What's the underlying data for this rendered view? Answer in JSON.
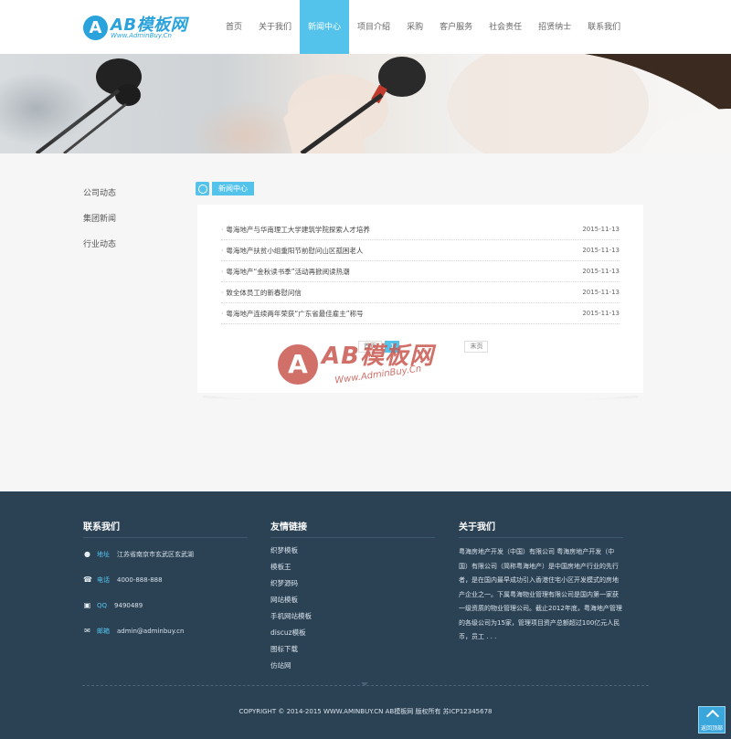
{
  "logo": {
    "mark": "A",
    "name": "AB模板网",
    "sub": "Www.AdminBuy.Cn"
  },
  "nav": [
    {
      "label": "首页"
    },
    {
      "label": "关于我们"
    },
    {
      "label": "新闻中心",
      "active": true
    },
    {
      "label": "项目介绍"
    },
    {
      "label": "采购"
    },
    {
      "label": "客户服务"
    },
    {
      "label": "社会责任"
    },
    {
      "label": "招贤纳士"
    },
    {
      "label": "联系我们"
    }
  ],
  "sidebar": {
    "items": [
      {
        "label": "公司动态"
      },
      {
        "label": "集团新闻"
      },
      {
        "label": "行业动态"
      }
    ]
  },
  "section": {
    "title": "新闻中心"
  },
  "news": [
    {
      "title": "粤海地产与华南理工大学建筑学院探索人才培养",
      "date": "2015-11-13"
    },
    {
      "title": "粤海地产扶贫小组重阳节前慰问山区孤困老人",
      "date": "2015-11-13"
    },
    {
      "title": "粤海地产“金秋读书季”活动再掀阅读热潮",
      "date": "2015-11-13"
    },
    {
      "title": "致全体员工的新春慰问信",
      "date": "2015-11-13"
    },
    {
      "title": "粤海地产连续两年荣获“广东省最佳雇主”称号",
      "date": "2015-11-13"
    }
  ],
  "pager": {
    "first": "首页",
    "current": "1",
    "last": "末页"
  },
  "watermark": {
    "mark": "A",
    "name": "AB模板网",
    "sub": "Www.AdminBuy.Cn"
  },
  "footer": {
    "contact": {
      "title": "联系我们",
      "rows": [
        {
          "icon": "location-icon",
          "label": "地址",
          "value": "江苏省南京市玄武区玄武湖"
        },
        {
          "icon": "phone-icon",
          "label": "电话",
          "value": "4000-888-888"
        },
        {
          "icon": "qq-icon",
          "label": "QQ",
          "value": "9490489"
        },
        {
          "icon": "mail-icon",
          "label": "邮箱",
          "value": "admin@adminbuy.cn"
        }
      ]
    },
    "links": {
      "title": "友情链接",
      "items": [
        "织梦模板",
        "模板王",
        "织梦源码",
        "网站模板",
        "手机网站模板",
        "discuz模板",
        "图标下载",
        "仿站网"
      ]
    },
    "about": {
      "title": "关于我们",
      "text": "粤海房地产开发（中国）有限公司 粤海房地产开发（中国）有限公司（简称粤海地产）是中国房地产行业的先行者，是在国内最早成功引入香港住宅小区开发模式的房地产企业之一。下属粤海物业管理有限公司是国内第一家获一级资质的物业管理公司。截止2012年底，粤海地产管理的各级公司为15家，管理项目资产总额超过100亿元人民币，员工 . . ."
    },
    "copyright": "COPYRIGHT © 2014-2015 WWW.AMINBUY.CN AB模板网 版权所有  苏ICP12345678",
    "back_top": "返回顶部"
  },
  "colors": {
    "accent": "#54c3ec",
    "footer_bg": "#2b4255",
    "watermark": "#c9574f"
  }
}
